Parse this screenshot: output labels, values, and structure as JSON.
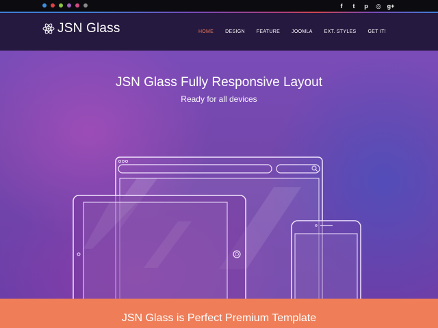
{
  "topbar": {
    "color_dots": [
      "#3d8fe0",
      "#e14141",
      "#8ec63f",
      "#a060c0",
      "#d14b7f",
      "#8a8a8a"
    ],
    "social_icons": [
      {
        "name": "facebook-icon",
        "glyph": "f"
      },
      {
        "name": "twitter-icon",
        "glyph": "t"
      },
      {
        "name": "pinterest-icon",
        "glyph": "p"
      },
      {
        "name": "dribbble-icon",
        "glyph": "◎"
      },
      {
        "name": "google-plus-icon",
        "glyph": "g+"
      }
    ]
  },
  "header": {
    "logo_text": "JSN Glass",
    "nav": [
      {
        "label": "HOME",
        "active": true
      },
      {
        "label": "DESIGN",
        "active": false
      },
      {
        "label": "FEATURE",
        "active": false
      },
      {
        "label": "JOOMLA",
        "active": false
      },
      {
        "label": "EXT. STYLES",
        "active": false
      },
      {
        "label": "GET IT!",
        "active": false
      }
    ],
    "active_color": "#f07a56"
  },
  "hero": {
    "title": "JSN Glass Fully Responsive Layout",
    "subtitle": "Ready for all devices"
  },
  "band": {
    "text": "JSN Glass is Perfect Premium Template",
    "color": "#ee7d58"
  }
}
